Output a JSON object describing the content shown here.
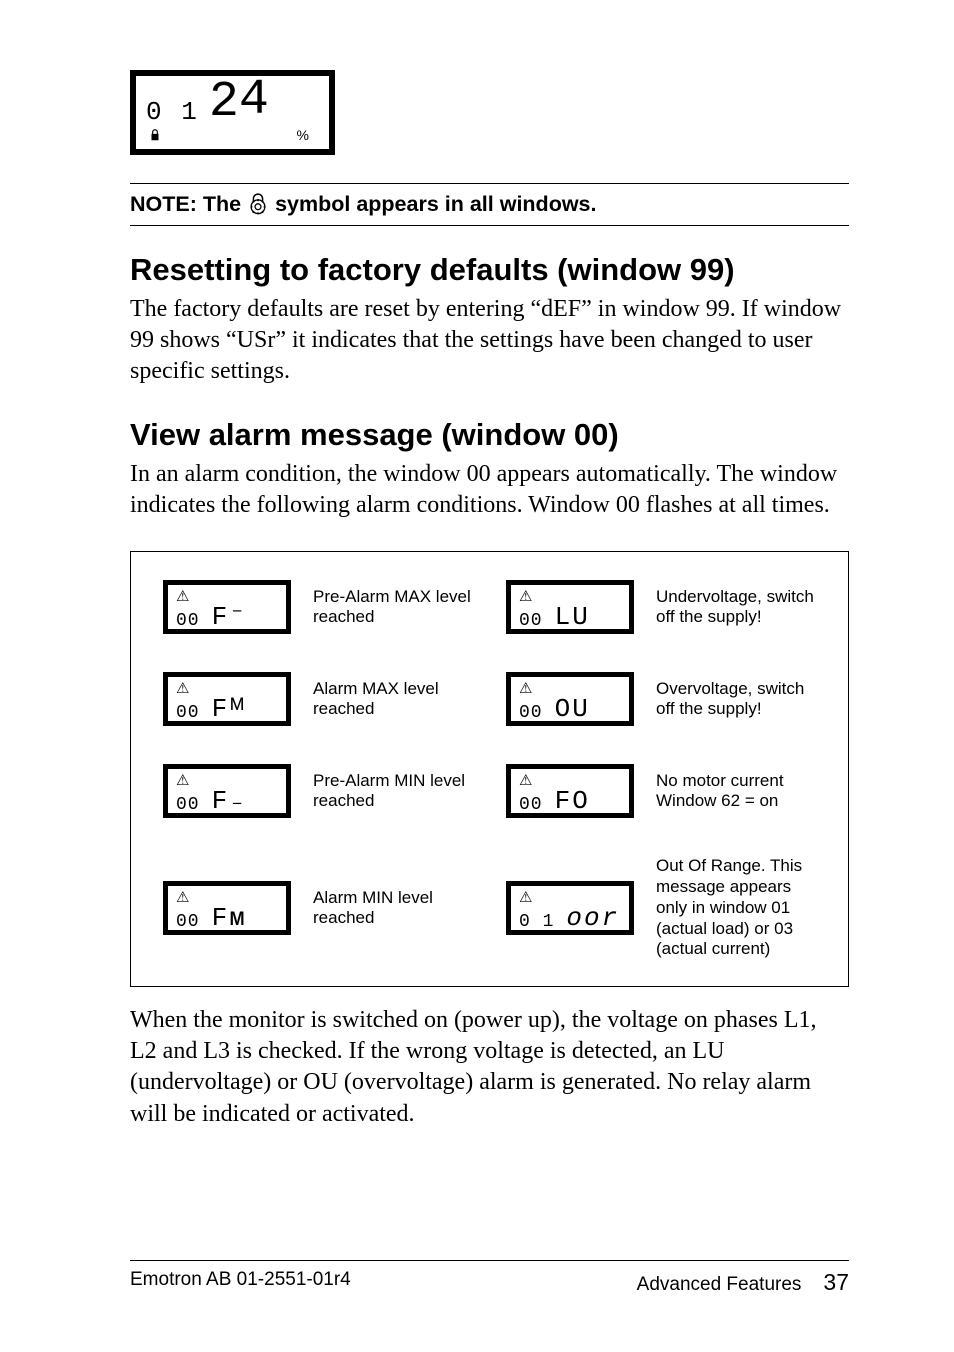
{
  "lcd_top": {
    "window_no": "0 1",
    "value": "24",
    "unit": "%"
  },
  "note": {
    "prefix": "NOTE: The",
    "suffix": "symbol appears in all windows."
  },
  "section1": {
    "heading": "Resetting to factory defaults (window 99)",
    "body": "The factory defaults are reset by entering “dEF” in window 99. If window 99 shows “USr” it indicates that the settings have been changed to user specific settings."
  },
  "section2": {
    "heading": "View alarm message (window 00)",
    "body": "In an alarm condition, the window 00 appears automatically. The window indicates the following alarm conditions. Window 00 flashes at all times."
  },
  "diagram": {
    "rows": [
      {
        "leftWin": "00",
        "leftVal": "F⁻",
        "leftCap": "Pre-Alarm MAX level reached",
        "rightWin": "00",
        "rightVal": "LU",
        "rightCap": "Undervoltage, switch off the supply!"
      },
      {
        "leftWin": "00",
        "leftVal": "Fᴹ",
        "leftCap": "Alarm MAX level reached",
        "rightWin": "00",
        "rightVal": "OU",
        "rightCap": "Overvoltage, switch off the supply!"
      },
      {
        "leftWin": "00",
        "leftVal": "F₋",
        "leftCap": "Pre-Alarm MIN level reached",
        "rightWin": "00",
        "rightVal": "FO",
        "rightCap": "No motor current Window 62 = on"
      },
      {
        "leftWin": "00",
        "leftVal": "Fᴍ",
        "leftCap": "Alarm MIN level reached",
        "rightWin": "0 1",
        "rightVal": "oor",
        "rightCap": "Out Of Range. This message appears only in window 01 (actual load) or 03 (actual current)",
        "rightItalic": true
      }
    ]
  },
  "para_after": "When the monitor is switched on (power up), the voltage on phases L1, L2 and L3 is checked. If the wrong voltage is detected, an LU (undervoltage) or OU (overvoltage) alarm is generated. No relay alarm will be indicated or activated.",
  "footer": {
    "left": "Emotron AB 01-2551-01r4",
    "right_label": "Advanced Features",
    "page": "37"
  }
}
